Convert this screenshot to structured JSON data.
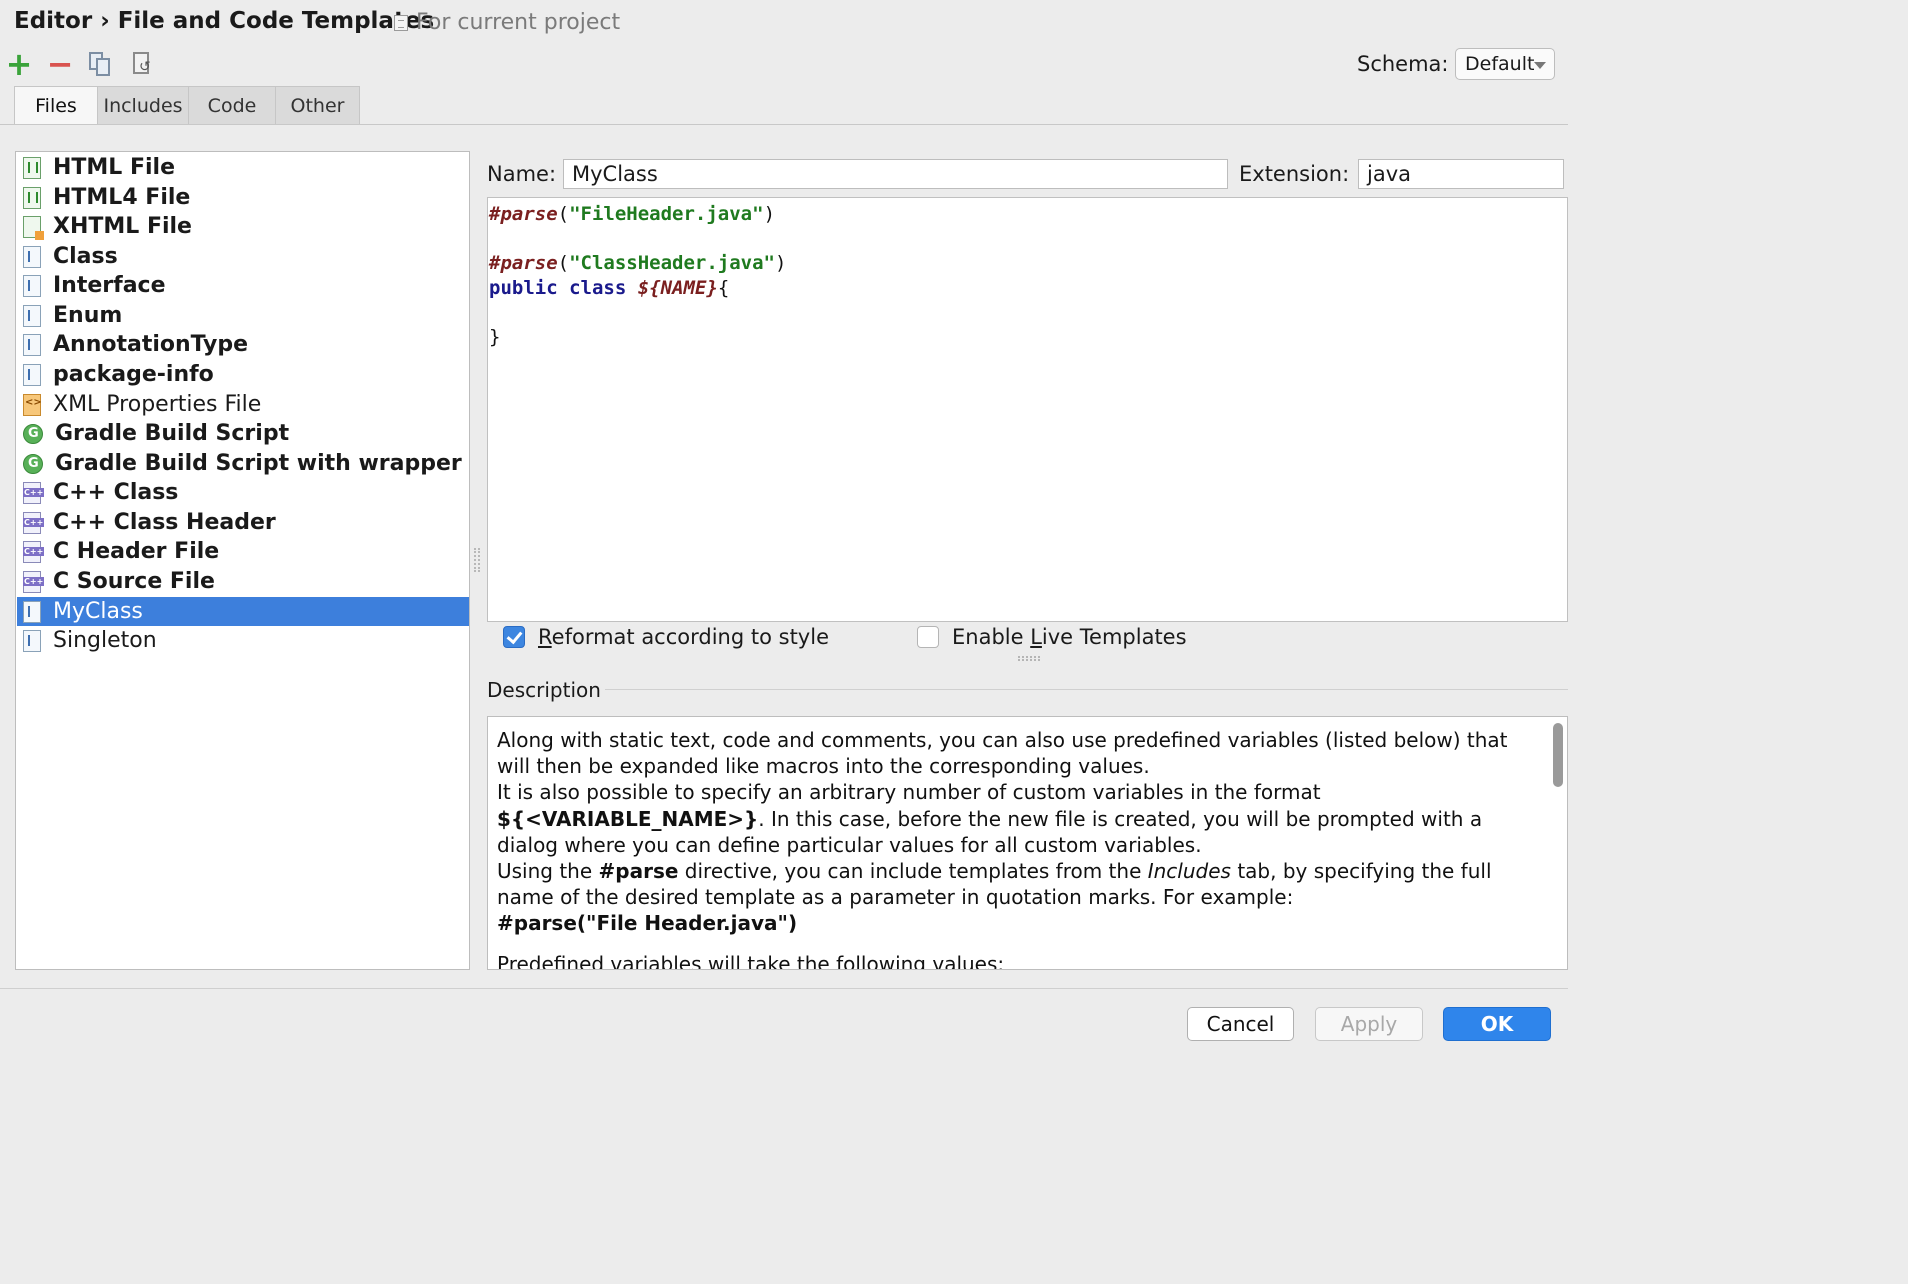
{
  "header": {
    "breadcrumb_parent": "Editor",
    "breadcrumb_separator": "›",
    "breadcrumb_current": "File and Code Templates",
    "scope_label": "For current project"
  },
  "toolbar": {
    "add_icon": "plus-icon",
    "remove_icon": "minus-icon",
    "copy_icon": "copy-icon",
    "reset_icon": "reset-icon",
    "schema_label": "Schema:",
    "schema_value": "Default"
  },
  "tabs": [
    {
      "label": "Files",
      "active": true
    },
    {
      "label": "Includes",
      "active": false
    },
    {
      "label": "Code",
      "active": false
    },
    {
      "label": "Other",
      "active": false
    }
  ],
  "templates": [
    {
      "label": "HTML File",
      "icon": "html-file-icon",
      "bold": true
    },
    {
      "label": "HTML4 File",
      "icon": "html-file-icon",
      "bold": true
    },
    {
      "label": "XHTML File",
      "icon": "xhtml-file-icon",
      "bold": true
    },
    {
      "label": "Class",
      "icon": "java-file-icon",
      "bold": true
    },
    {
      "label": "Interface",
      "icon": "java-file-icon",
      "bold": true
    },
    {
      "label": "Enum",
      "icon": "java-file-icon",
      "bold": true
    },
    {
      "label": "AnnotationType",
      "icon": "java-file-icon",
      "bold": true
    },
    {
      "label": "package-info",
      "icon": "java-file-icon",
      "bold": true
    },
    {
      "label": "XML Properties File",
      "icon": "xml-file-icon",
      "bold": false
    },
    {
      "label": "Gradle Build Script",
      "icon": "gradle-icon",
      "bold": true
    },
    {
      "label": "Gradle Build Script with wrapper",
      "icon": "gradle-icon",
      "bold": true
    },
    {
      "label": "C++ Class",
      "icon": "cpp-file-icon",
      "bold": true
    },
    {
      "label": "C++ Class Header",
      "icon": "cpp-file-icon",
      "bold": true
    },
    {
      "label": "C Header File",
      "icon": "cpp-file-icon",
      "bold": true
    },
    {
      "label": "C Source File",
      "icon": "cpp-file-icon",
      "bold": true
    },
    {
      "label": "MyClass",
      "icon": "java-file-icon",
      "bold": false,
      "selected": true
    },
    {
      "label": "Singleton",
      "icon": "java-file-icon",
      "bold": false
    }
  ],
  "editor": {
    "name_label": "Name:",
    "name_value": "MyClass",
    "extension_label": "Extension:",
    "extension_value": "java",
    "code": {
      "line1_directive": "#parse",
      "line1_open": "(",
      "line1_string": "\"FileHeader.java\"",
      "line1_close": ")",
      "line3_directive": "#parse",
      "line3_open": "(",
      "line3_string": "\"ClassHeader.java\"",
      "line3_close": ")",
      "line4_keyword1": "public",
      "line4_keyword2": "class",
      "line4_var": "${NAME}",
      "line4_brace": "{",
      "line6_brace": "}"
    }
  },
  "options": {
    "reformat_label": "Reformat according to style",
    "reformat_mnemonic": "R",
    "reformat_rest": "eformat according to style",
    "reformat_checked": true,
    "live_label_pre": "Enable ",
    "live_mnemonic": "L",
    "live_label_post": "ive Templates",
    "live_checked": false
  },
  "description": {
    "title": "Description",
    "p1": "Along with static text, code and comments, you can also use predefined variables (listed below) that will then be expanded like macros into the corresponding values.",
    "p2_pre": "It is also possible to specify an arbitrary number of custom variables in the format",
    "p2_var": "${<VARIABLE_NAME>}",
    "p2_post": ". In this case, before the new file is created, you will be prompted with a dialog where you can define particular values for all custom variables.",
    "p3_pre": "Using the ",
    "p3_directive": "#parse",
    "p3_mid": " directive, you can include templates from the ",
    "p3_tab": "Includes",
    "p3_post": " tab, by specifying the full name of the desired template as a parameter in quotation marks. For example:",
    "p4_example": "#parse(\"File Header.java\")",
    "p5": "Predefined variables will take the following values:"
  },
  "footer": {
    "cancel_label": "Cancel",
    "apply_label": "Apply",
    "ok_label": "OK"
  }
}
